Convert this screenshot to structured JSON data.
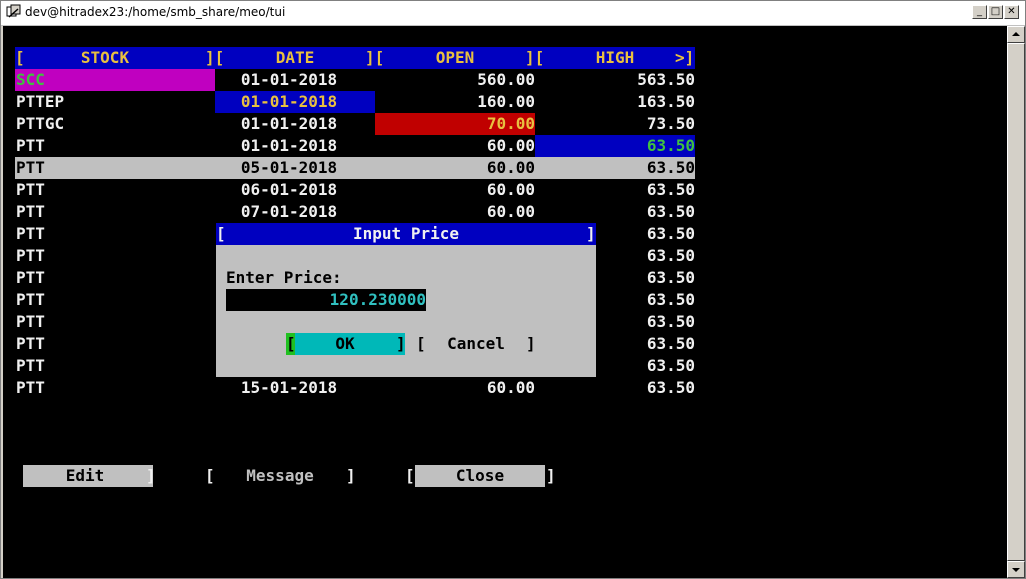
{
  "window": {
    "title": "dev@hitradex23:/home/smb_share/meo/tui"
  },
  "table": {
    "headers": [
      "STOCK",
      "DATE",
      "OPEN",
      "HIGH"
    ],
    "rows": [
      {
        "stock": "SCC",
        "date": "01-01-2018",
        "open": "560.00",
        "high": "563.50"
      },
      {
        "stock": "PTTEP",
        "date": "01-01-2018",
        "open": "160.00",
        "high": "163.50"
      },
      {
        "stock": "PTTGC",
        "date": "01-01-2018",
        "open": "70.00",
        "high": "73.50"
      },
      {
        "stock": "PTT",
        "date": "01-01-2018",
        "open": "60.00",
        "high": "63.50"
      },
      {
        "stock": "PTT",
        "date": "05-01-2018",
        "open": "60.00",
        "high": "63.50"
      },
      {
        "stock": "PTT",
        "date": "06-01-2018",
        "open": "60.00",
        "high": "63.50"
      },
      {
        "stock": "PTT",
        "date": "07-01-2018",
        "open": "60.00",
        "high": "63.50"
      },
      {
        "stock": "PTT",
        "date": "",
        "open": "",
        "high": "63.50"
      },
      {
        "stock": "PTT",
        "date": "",
        "open": "",
        "high": "63.50"
      },
      {
        "stock": "PTT",
        "date": "",
        "open": "",
        "high": "63.50"
      },
      {
        "stock": "PTT",
        "date": "",
        "open": "",
        "high": "63.50"
      },
      {
        "stock": "PTT",
        "date": "",
        "open": "",
        "high": "63.50"
      },
      {
        "stock": "PTT",
        "date": "",
        "open": "",
        "high": "63.50"
      },
      {
        "stock": "PTT",
        "date": "",
        "open": "",
        "high": "63.50"
      },
      {
        "stock": "PTT",
        "date": "15-01-2018",
        "open": "60.00",
        "high": "63.50"
      }
    ]
  },
  "dialog": {
    "title": "Input Price",
    "label": "Enter Price:",
    "value": "120.230000",
    "ok": "OK",
    "cancel": "Cancel"
  },
  "buttons": {
    "edit": "Edit",
    "message": "Message",
    "close": "Close"
  },
  "colors": {
    "header_bg": "#0000c0",
    "header_fg": "#e8c040",
    "selected_stock_bg": "#c000c0",
    "selected_date_bg": "#0000c0",
    "selected_open_bg": "#c00000",
    "selected_high_bg": "#0000c0",
    "highlight_row_bg": "#c0c0c0",
    "ok_bg": "#00b8b8"
  }
}
